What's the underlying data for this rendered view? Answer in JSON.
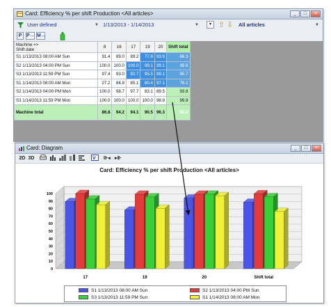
{
  "card1": {
    "title": "Card: Efficiency % per shift Production <All articles>",
    "window_buttons": [
      "_",
      "□",
      "×"
    ],
    "filter_mode": "User defined",
    "date_range": "1/13/2013 - 1/14/2013",
    "article_filter": "All articles",
    "icon_buttons": [
      "P",
      "P↔",
      "M↔"
    ],
    "table": {
      "header_row_label": "Machine => \nShift date",
      "machine_columns": [
        "8",
        "16",
        "17",
        "19",
        "20"
      ],
      "shift_total_header": "Shift total",
      "rows": [
        {
          "label": "S1 1/13/2013 08:00 AM Sun",
          "values": [
            "91.4",
            "89.0",
            "89.2",
            "77.9",
            "93.9"
          ],
          "total": "88.3"
        },
        {
          "label": "S2 1/13/2013 04:00 PM Sun",
          "values": [
            "100.0",
            "100.0",
            "100.0",
            "99.1",
            "99.1"
          ],
          "total": "99.6"
        },
        {
          "label": "S3 1/13/2013 11:59 PM Sun",
          "values": [
            "97.4",
            "93.0",
            "92.7",
            "95.5",
            "99.1"
          ],
          "total": "95.7"
        },
        {
          "label": "S1 1/14/2013 08:00 AM Mon",
          "values": [
            "27.2",
            "84.8",
            "85.1",
            "80.4",
            "97.1"
          ],
          "total": "76.1"
        },
        {
          "label": "S2 1/14/2013 04:00 PM Mon",
          "values": [
            "100.0",
            "98.7",
            "97.7",
            "83.1",
            "89.5"
          ],
          "total": "93.8"
        },
        {
          "label": "S3 1/14/2013 11:59 PM Mon",
          "values": [
            "100.0",
            "100.0",
            "100.0",
            "100.0",
            "98.9"
          ],
          "total": "99.8"
        }
      ],
      "total_label": "Machine total",
      "totals": [
        "86.8",
        "94.2",
        "94.1",
        "90.5",
        "96.3"
      ],
      "grand_total": "92.2"
    }
  },
  "card2": {
    "title": "Card: Diagram",
    "window_buttons": [
      "_",
      "□",
      "×"
    ],
    "toolbar_labels": [
      "2D",
      "3D"
    ],
    "chart_title": "Card:  Efficiency % per shift Production <All articles>"
  },
  "chart_data": {
    "type": "bar",
    "title": "Card:  Efficiency % per shift Production <All articles>",
    "categories": [
      "17",
      "19",
      "20",
      "Shift total"
    ],
    "ylim": [
      0,
      100
    ],
    "yticks": [
      "0",
      "10",
      "20",
      "30",
      "40",
      "50",
      "60",
      "70",
      "80",
      "90",
      "100"
    ],
    "xlabel": "",
    "ylabel": "",
    "grid": true,
    "legend_position": "bottom",
    "series": [
      {
        "name": "S1 1/13/2013 08:00 AM Sun",
        "color": "#4a55e8",
        "values": [
          89.2,
          77.9,
          93.9,
          88.3
        ]
      },
      {
        "name": "S2 1/13/2013 04:00 PM Sun",
        "color": "#e23b3b",
        "values": [
          100.0,
          99.1,
          99.1,
          99.6
        ]
      },
      {
        "name": "S3 1/13/2013 11:59 PM Sun",
        "color": "#38cf38",
        "values": [
          92.7,
          95.5,
          99.1,
          95.7
        ]
      },
      {
        "name": "S1 1/14/2013 08:00 AM Mon",
        "color": "#f1f13a",
        "values": [
          85.1,
          80.4,
          97.1,
          76.1
        ]
      }
    ]
  }
}
